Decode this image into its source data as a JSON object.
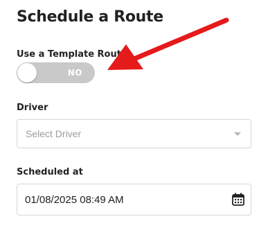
{
  "title": "Schedule a Route",
  "template_route": {
    "label": "Use a Template Route",
    "toggle_text": "NO"
  },
  "driver": {
    "label": "Driver",
    "placeholder": "Select Driver"
  },
  "scheduled_at": {
    "label": "Scheduled at",
    "value": "01/08/2025 08:49 AM"
  },
  "icons": {
    "dropdown": "chevron-down-icon",
    "calendar": "calendar-icon",
    "annotation": "red-arrow"
  },
  "colors": {
    "toggle_off": "#c9c9c9",
    "annotation_arrow": "#e51a1a"
  }
}
